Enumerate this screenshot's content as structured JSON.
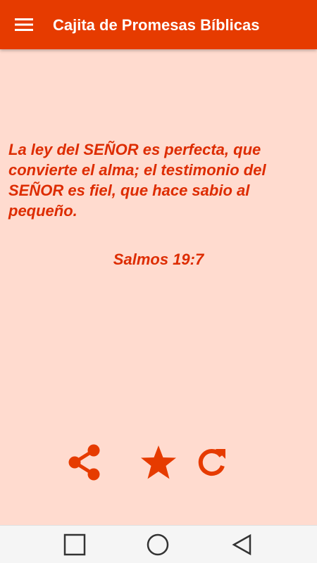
{
  "app_bar": {
    "title": "Cajita de Promesas Bíblicas",
    "menu_icon": "hamburger-menu-icon"
  },
  "promise": {
    "verse": "La ley del SEÑOR es perfecta, que convierte el alma; el testimonio del SEÑOR es fiel, que hace sabio al pequeño.",
    "reference": "Salmos 19:7"
  },
  "actions": [
    {
      "name": "share",
      "icon": "share-icon"
    },
    {
      "name": "favorite",
      "icon": "star-icon"
    },
    {
      "name": "refresh",
      "icon": "refresh-icon"
    }
  ],
  "system_nav": {
    "recents_icon": "square-icon",
    "home_icon": "circle-icon",
    "back_icon": "triangle-back-icon"
  },
  "colors": {
    "primary": "#e63b00",
    "accent_text": "#dd2c00",
    "background": "#ffdbcf",
    "nav_bar": "#f5f5f5"
  }
}
